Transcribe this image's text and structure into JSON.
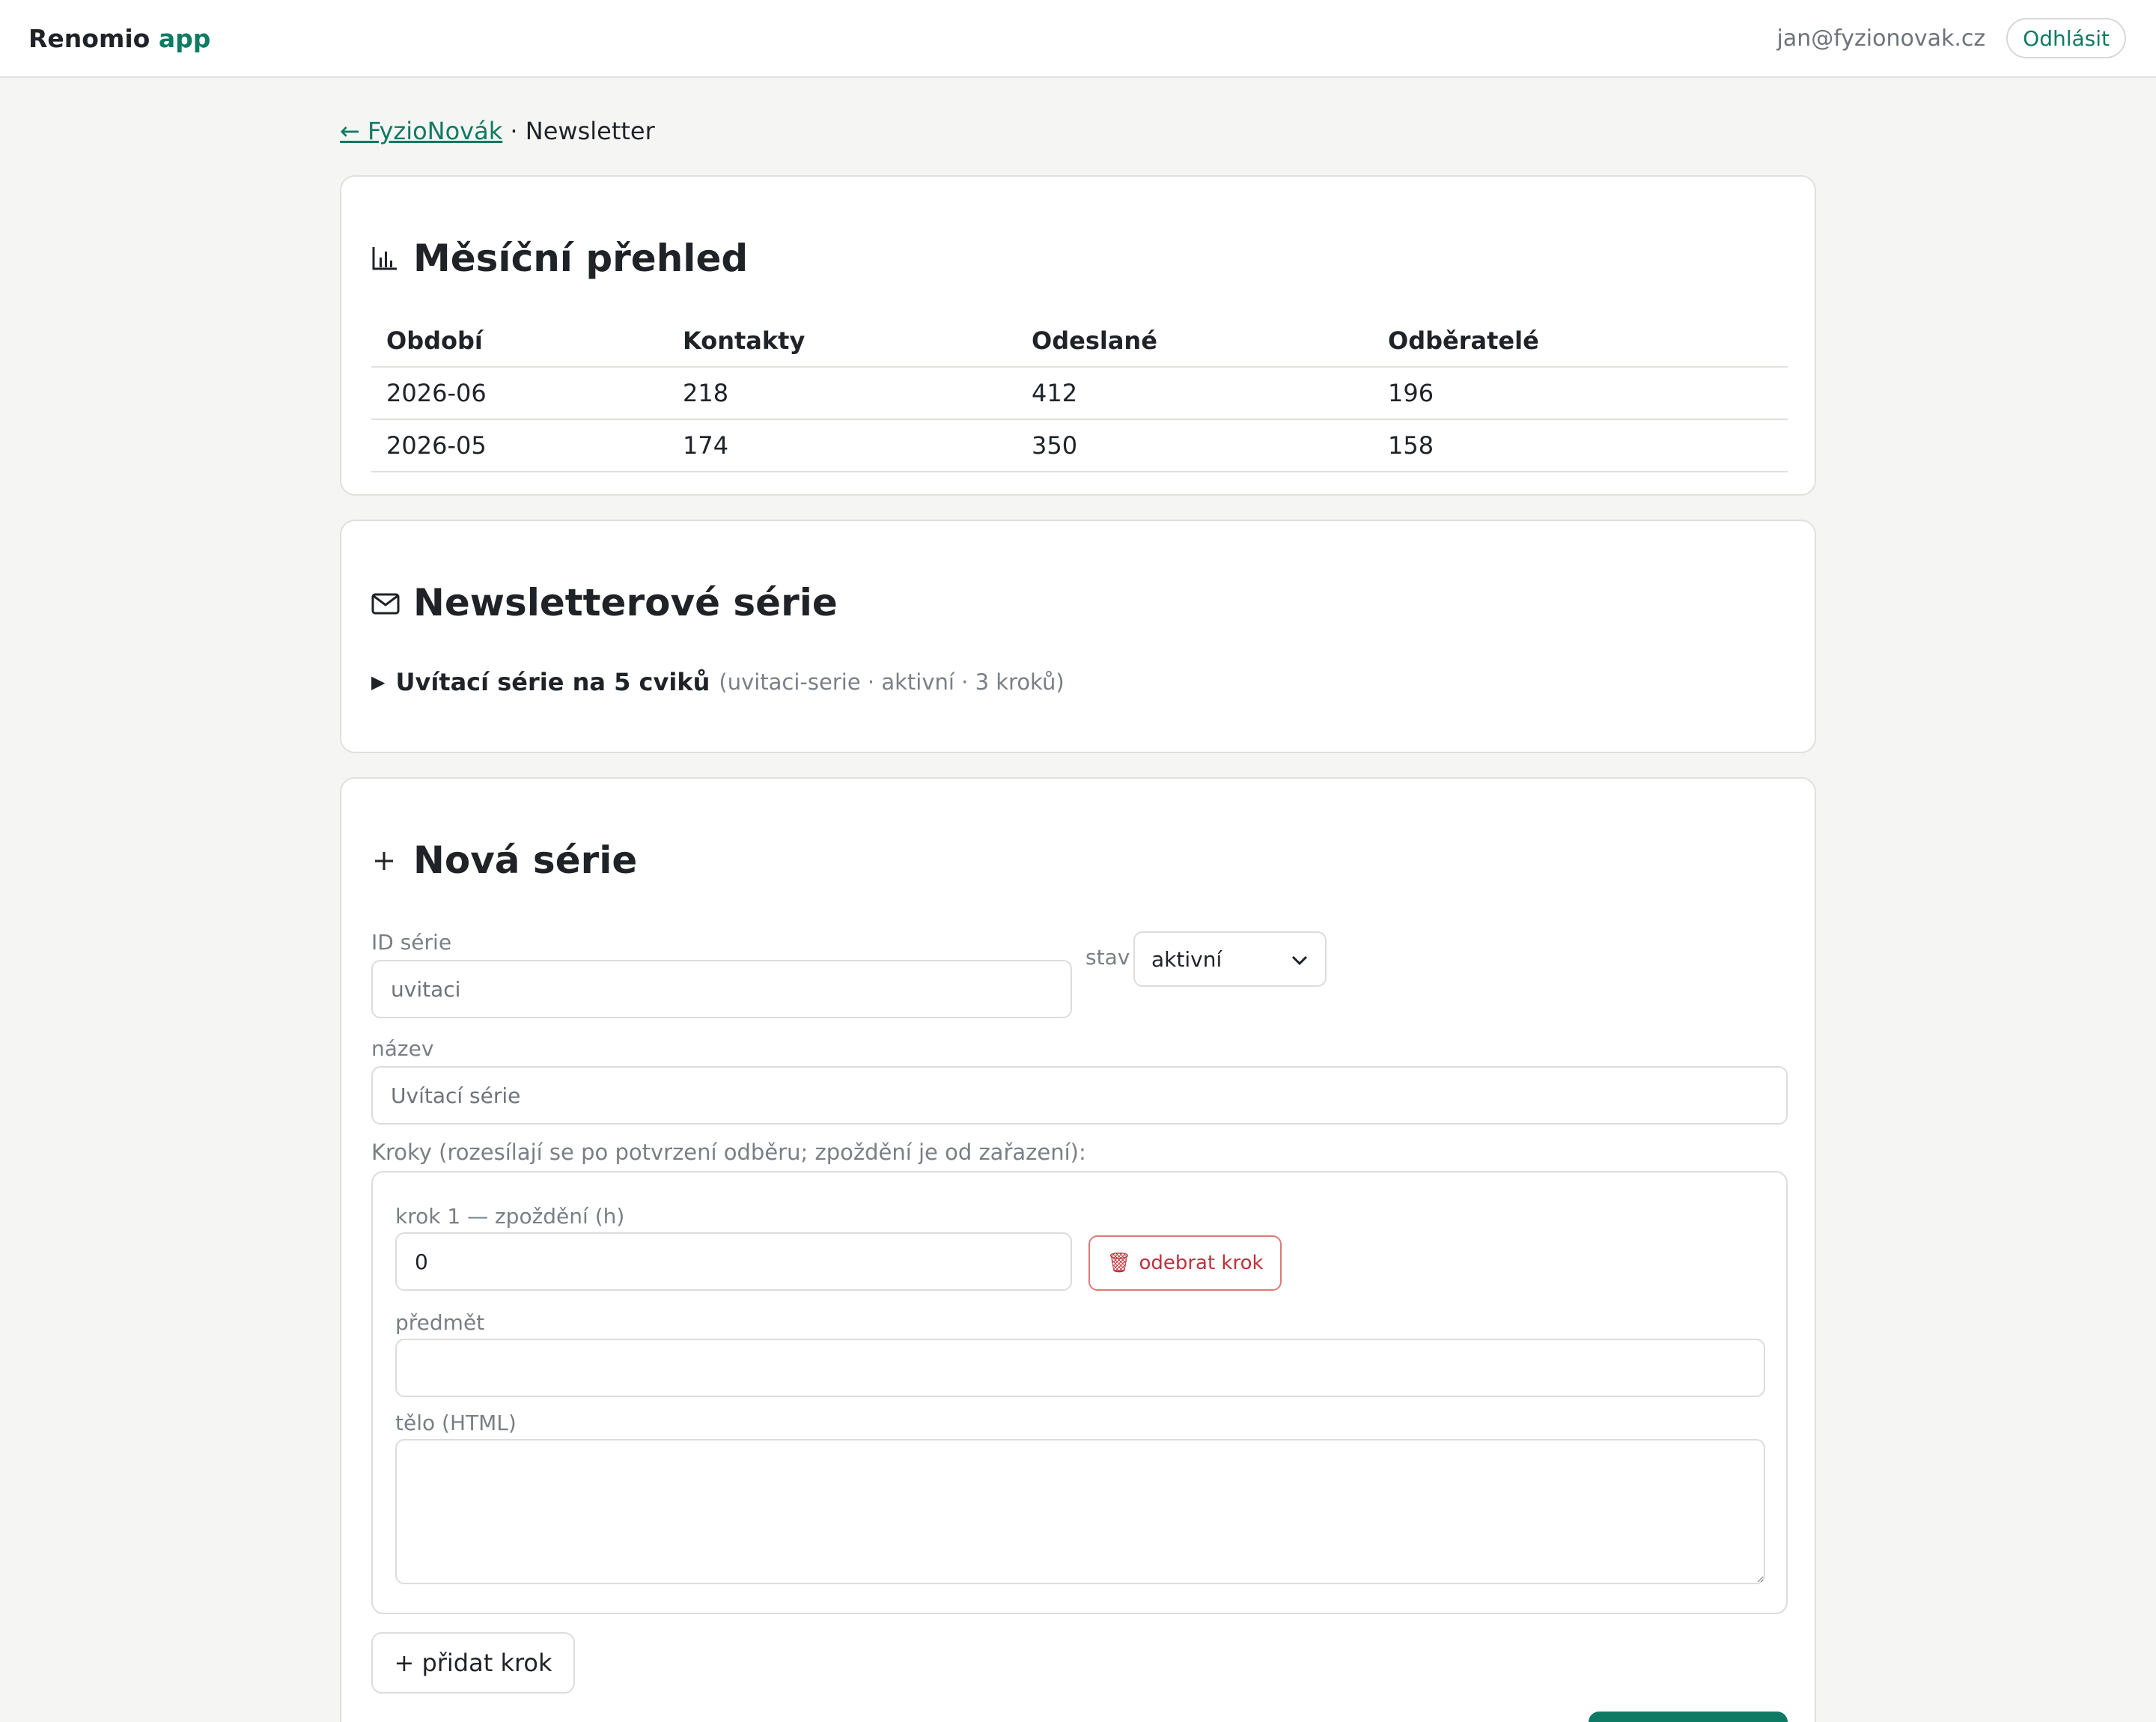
{
  "header": {
    "brand": "Renomio",
    "brand_accent": "app",
    "user_email": "jan@fyzionovak.cz",
    "logout_label": "Odhlásit"
  },
  "breadcrumb": {
    "back_link": "← FyzioNovák",
    "separator": "·",
    "current": "Newsletter"
  },
  "overview": {
    "title": "Měsíční přehled",
    "icon": "bar-chart-icon",
    "columns": [
      "Období",
      "Kontakty",
      "Odeslané",
      "Odběratelé"
    ],
    "rows": [
      [
        "2026-06",
        "218",
        "412",
        "196"
      ],
      [
        "2026-05",
        "174",
        "350",
        "158"
      ]
    ]
  },
  "series": {
    "title": "Newsletterové série",
    "icon": "envelope-icon",
    "items": [
      {
        "name": "Uvítací série na 5 cviků",
        "meta": "(uvitaci-serie · aktivní · 3 kroků)"
      }
    ]
  },
  "new_series": {
    "title": "Nová série",
    "icon": "plus-icon",
    "id_label": "ID série",
    "id_placeholder": "uvitaci",
    "state_label": "stav",
    "state_value": "aktivní",
    "name_label": "název",
    "name_placeholder": "Uvítací série",
    "steps_label": "Kroky (rozesílají se po potvrzení odběru; zpoždění je od zařazení):",
    "step": {
      "delay_label": "krok 1 — zpoždění (h)",
      "delay_value": "0",
      "remove_label": "odebrat krok",
      "subject_label": "předmět",
      "subject_value": "",
      "body_label": "tělo (HTML)",
      "body_value": ""
    },
    "add_step_label": "+ přidat krok"
  },
  "colors": {
    "accent": "#0f7a63",
    "danger": "#c0303a",
    "background": "#f5f5f3"
  }
}
